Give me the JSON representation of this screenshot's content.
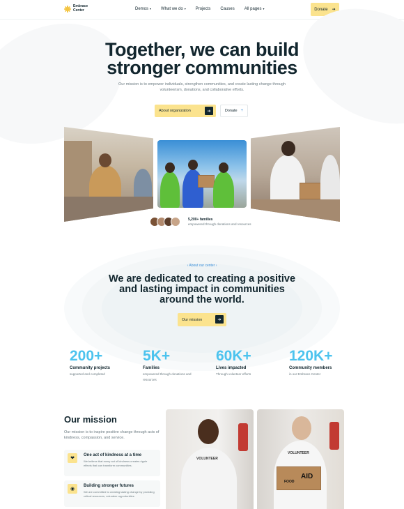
{
  "brand": {
    "name": "Embrace Center",
    "accent": "#fbe38e",
    "dark": "#12262e",
    "stat_color": "#4cc3ee"
  },
  "nav": {
    "items": [
      {
        "label": "Demos",
        "dropdown": true
      },
      {
        "label": "What we do",
        "dropdown": true
      },
      {
        "label": "Projects",
        "dropdown": false
      },
      {
        "label": "Causes",
        "dropdown": false
      },
      {
        "label": "All pages",
        "dropdown": true
      }
    ],
    "donate_label": "Donate",
    "donate_icon": "arrow-right-icon"
  },
  "hero": {
    "title_line1": "Together, we can build",
    "title_line2": "stronger communities",
    "subtitle": "Our mission is to empower individuals, strengthen communities, and create lasting change through volunteerism, donations, and collaborative efforts.",
    "primary_label": "About organization",
    "secondary_label": "Donate",
    "families_count": "5,200+ families",
    "families_sub": "empowered through donations and resources"
  },
  "about": {
    "kicker": "About our center",
    "title": "We are dedicated to creating a positive and lasting impact in communities around the world.",
    "button_label": "Our mission"
  },
  "stats": [
    {
      "value": "200+",
      "label": "Community projects",
      "desc": "supported and completed"
    },
    {
      "value": "5K+",
      "label": "Families",
      "desc": "empowered through donations and resources"
    },
    {
      "value": "60K+",
      "label": "Lives impacted",
      "desc": "Through volunteer efforts"
    },
    {
      "value": "120K+",
      "label": "Community members",
      "desc": "in our Embrace Center"
    }
  ],
  "mission": {
    "title": "Our mission",
    "subtitle": "Our mission is to inspire positive change through acts of kindness, compassion, and service.",
    "cards": [
      {
        "title": "One act of kindness at a time",
        "desc": "We believe that every act of kindness creates ripple effects that can transform communities.",
        "icon": "heart-hands-icon"
      },
      {
        "title": "Building stronger futures",
        "desc": "We are committed to creating lasting change by providing critical resources, volunteer opportunities",
        "icon": "growth-icon"
      }
    ],
    "shirt_text": "VOLUNTEER",
    "box_text_1": "FOOD",
    "box_text_2": "AID"
  }
}
